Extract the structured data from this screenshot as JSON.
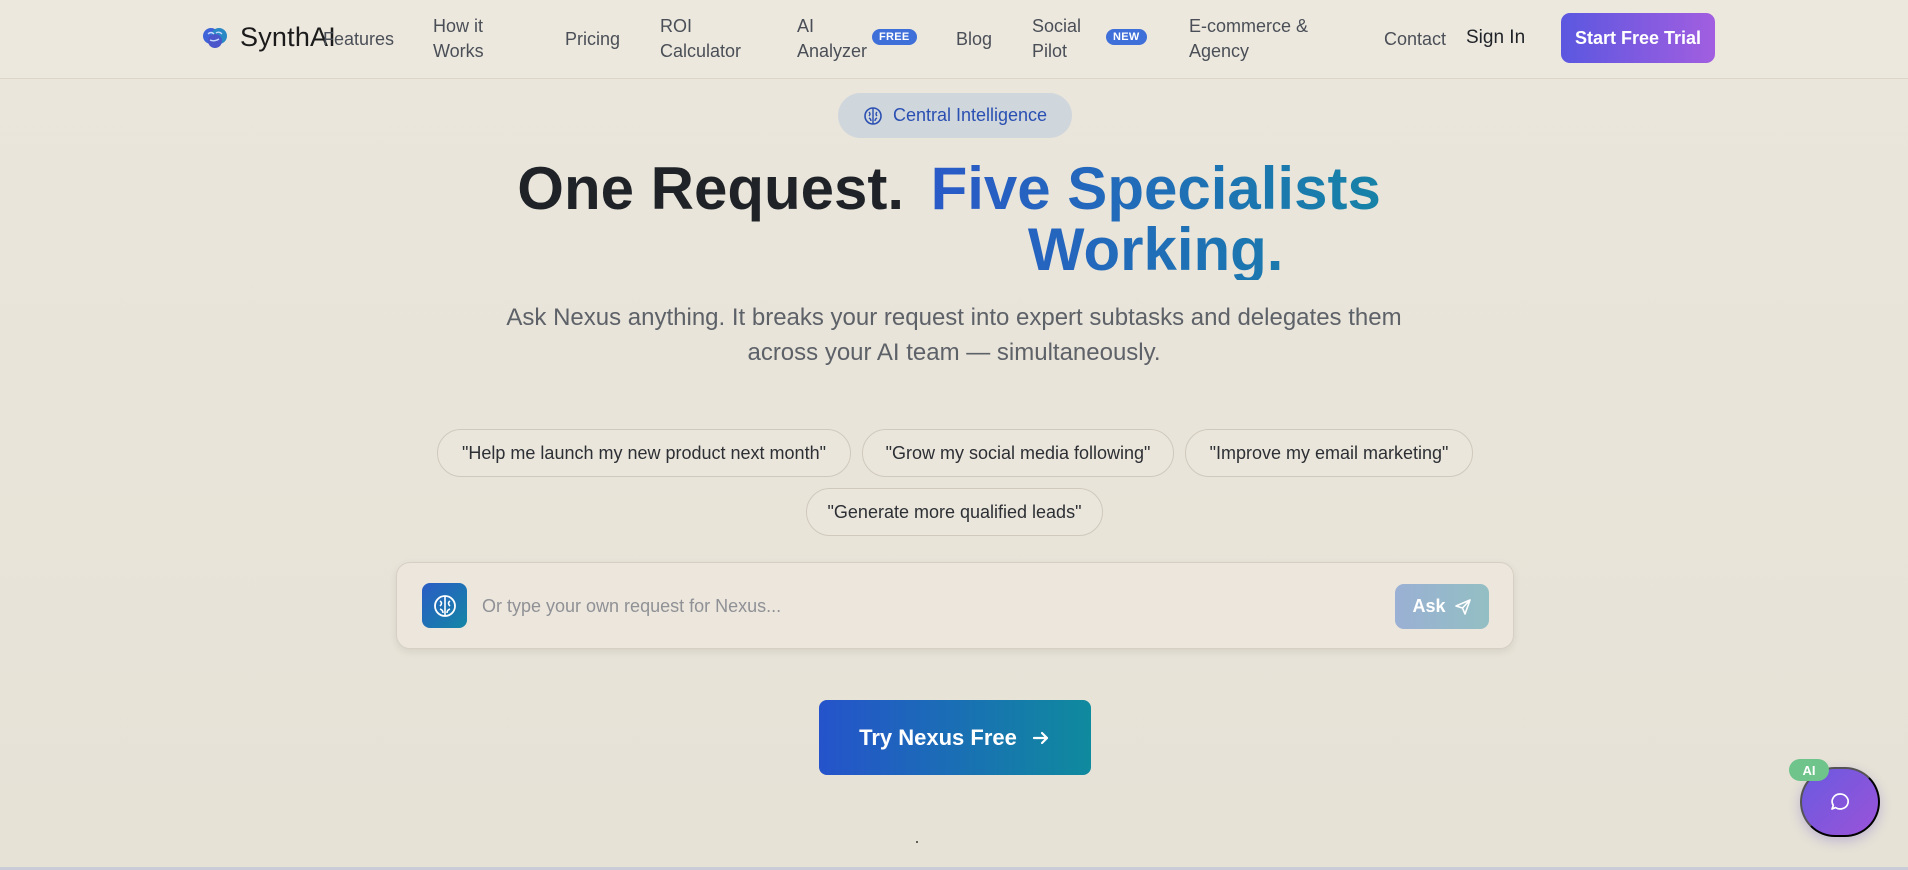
{
  "brand": {
    "name": "SynthAI"
  },
  "nav": {
    "items": [
      {
        "label": "Features"
      },
      {
        "label": "How it Works"
      },
      {
        "label": "Pricing"
      },
      {
        "label": "ROI Calculator"
      },
      {
        "label": "AI Analyzer",
        "badge": "FREE"
      },
      {
        "label": "Blog"
      },
      {
        "label": "Social Pilot",
        "badge": "NEW"
      },
      {
        "label": "E-commerce & Agency"
      },
      {
        "label": "Contact"
      }
    ],
    "sign_in": "Sign In",
    "cta": "Start Free Trial"
  },
  "hero": {
    "pill": "Central Intelligence",
    "title_part1": "One Request.",
    "title_part2": "Five Specialists Working.",
    "subtitle": "Ask Nexus anything. It breaks your request into expert subtasks and delegates them across your AI team — simultaneously.",
    "suggestions": [
      "\"Help me launch my new product next month\"",
      "\"Grow my social media following\"",
      "\"Improve my email marketing\"",
      "\"Generate more qualified leads\""
    ],
    "input_placeholder": "Or type your own request for Nexus...",
    "ask_label": "Ask",
    "try_label": "Try Nexus Free"
  },
  "chat": {
    "badge": "AI"
  },
  "colors": {
    "accent_blue": "#2a59c8",
    "accent_teal": "#1683a6",
    "cta_purple": "#5b57e0",
    "badge_green": "#6ec48a"
  }
}
